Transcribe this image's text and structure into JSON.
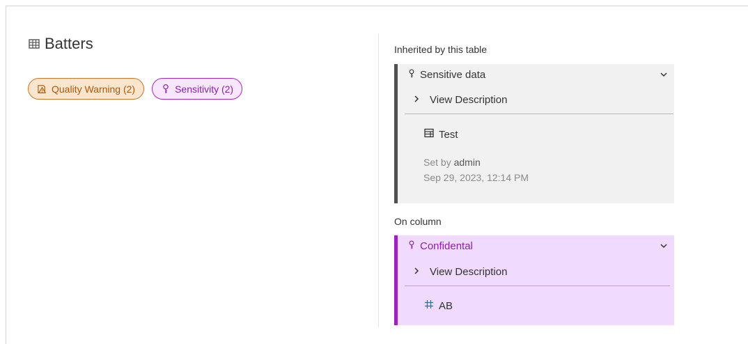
{
  "header": {
    "title": "Batters",
    "title_icon": "table-icon"
  },
  "badges": [
    {
      "label": "Quality Warning (2)",
      "icon": "quality-warning-icon",
      "color": "#c8762a"
    },
    {
      "label": "Sensitivity (2)",
      "icon": "sensitivity-icon",
      "color": "#a624c4"
    }
  ],
  "inherited": {
    "section_label": "Inherited by this table",
    "card": {
      "title": "Sensitive data",
      "icon": "sensitivity-icon",
      "view_description": "View Description",
      "asset_name": "Test",
      "asset_icon": "database-table-icon",
      "set_by_prefix": "Set by",
      "set_by_user": "admin",
      "timestamp": "Sep 29, 2023, 12:14 PM",
      "accent": "#505050"
    }
  },
  "on_column": {
    "section_label": "On column",
    "card": {
      "title": "Confidental",
      "icon": "sensitivity-icon",
      "view_description": "View Description",
      "asset_name": "AB",
      "asset_icon": "number-column-icon",
      "accent": "#9a23c0"
    }
  }
}
